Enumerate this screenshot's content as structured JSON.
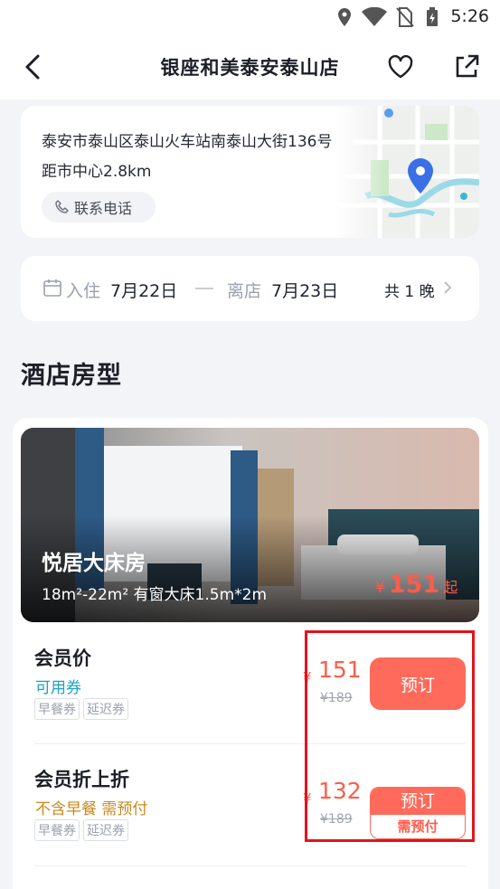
{
  "status_bar": {
    "time": "5:26"
  },
  "nav": {
    "title": "银座和美泰安泰山店"
  },
  "address": {
    "line": "泰安市泰山区泰山火车站南泰山大街136号",
    "distance": "距市中心2.8km",
    "phone_label": "联系电话"
  },
  "dates": {
    "checkin_label": "入住",
    "checkin": "7月22日",
    "checkout_label": "离店",
    "checkout": "7月23日",
    "nights": "共 1 晚"
  },
  "section_title": "酒店房型",
  "room": {
    "name": "悦居大床房",
    "spec": "18m²-22m² 有窗大床1.5m*2m",
    "currency": "¥",
    "price": "151",
    "price_suffix": "起"
  },
  "rates": [
    {
      "name": "会员价",
      "sub": "可用券",
      "sub_color": "#1aa1c6",
      "tags": [
        "早餐券",
        "延迟券"
      ],
      "currency": "¥",
      "price": "151",
      "original": "¥189",
      "book": "预订"
    },
    {
      "name": "会员折上折",
      "sub": "不含早餐 需预付",
      "sub_color": "#c8881a",
      "tags": [
        "早餐券",
        "延迟券"
      ],
      "currency": "¥",
      "price": "132",
      "original": "¥189",
      "book": "预订",
      "book_note": "需预付"
    }
  ],
  "colors": {
    "accent": "#ff6a5a",
    "highlight": "#e3141b"
  }
}
